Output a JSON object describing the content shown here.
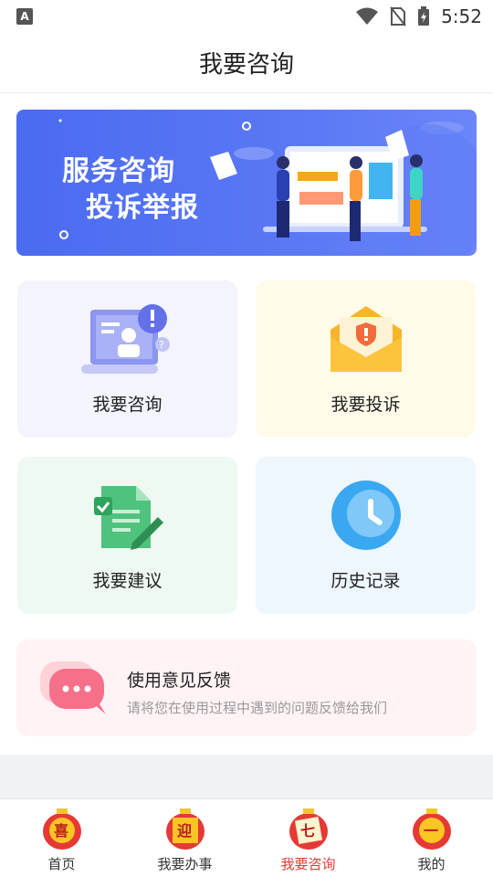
{
  "status_bar": {
    "time": "5:52",
    "left_badge": "A"
  },
  "header": {
    "title": "我要咨询"
  },
  "banner": {
    "line1": "服务咨询",
    "line2": "投诉举报"
  },
  "cards": [
    {
      "label": "我要咨询",
      "icon": "consult-icon",
      "bg": "#f3f4fd"
    },
    {
      "label": "我要投诉",
      "icon": "complaint-envelope-icon",
      "bg": "#fffbea"
    },
    {
      "label": "我要建议",
      "icon": "suggestion-document-icon",
      "bg": "#edf9f1"
    },
    {
      "label": "历史记录",
      "icon": "history-clock-icon",
      "bg": "#eef6fe"
    }
  ],
  "feedback": {
    "title": "使用意见反馈",
    "subtitle": "请将您在使用过程中遇到的问题反馈给我们"
  },
  "tabs": [
    {
      "label": "首页",
      "glyph": "喜",
      "active": false
    },
    {
      "label": "我要办事",
      "glyph": "迎",
      "active": false
    },
    {
      "label": "我要咨询",
      "glyph": "七",
      "active": true
    },
    {
      "label": "我的",
      "glyph": "一",
      "active": false
    }
  ],
  "colors": {
    "accent": "#e53935",
    "banner": "#4b6bf0"
  }
}
